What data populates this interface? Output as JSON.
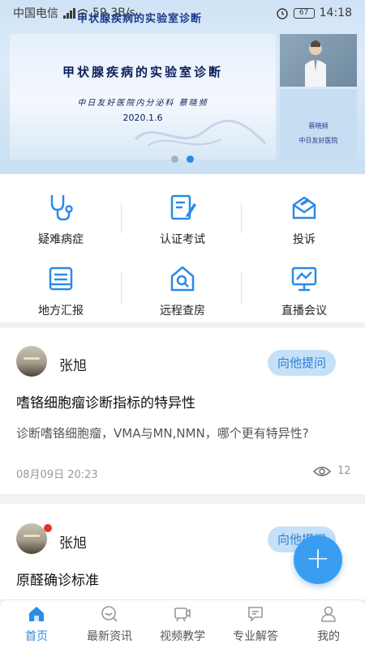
{
  "status": {
    "carrier": "中国电信",
    "net_speed": "59.3B/s",
    "battery": "67",
    "time": "14:18"
  },
  "banner": {
    "top_title": "甲状腺疾病的实验室诊断",
    "title": "甲状腺疾病的实验室诊断",
    "subtitle": "中日友好医院内分泌科 蔡晓频",
    "date": "2020.1.6",
    "side_name": "蔡晓频",
    "side_hospital": "中日友好医院",
    "slide_count": 2,
    "active_slide": 2
  },
  "menu": [
    {
      "label": "疑难病症",
      "icon": "stethoscope-icon"
    },
    {
      "label": "认证考试",
      "icon": "edit-document-icon"
    },
    {
      "label": "投诉",
      "icon": "complaint-envelope-icon"
    },
    {
      "label": "地方汇报",
      "icon": "report-icon"
    },
    {
      "label": "远程查房",
      "icon": "remote-ward-icon"
    },
    {
      "label": "直播会议",
      "icon": "live-meeting-icon"
    }
  ],
  "posts": [
    {
      "user": "张旭",
      "ask_label": "向他提问",
      "title": "嗜铬细胞瘤诊断指标的特异性",
      "description": "诊断嗜铬细胞瘤，VMA与MN,NMN，哪个更有特异性?",
      "time": "08月09日 20:23",
      "views": "12"
    },
    {
      "user": "张旭",
      "ask_label": "向他提问",
      "title": "原醛确诊标准"
    }
  ],
  "fab_label": "+",
  "tabs": [
    {
      "label": "首页",
      "icon": "home-icon",
      "active": true
    },
    {
      "label": "最新资讯",
      "icon": "news-icon"
    },
    {
      "label": "视频教学",
      "icon": "video-icon"
    },
    {
      "label": "专业解答",
      "icon": "answer-icon"
    },
    {
      "label": "我的",
      "icon": "profile-icon"
    }
  ],
  "colors": {
    "accent": "#2b8be6",
    "ask_bg": "#c6e1f7",
    "fab": "#3a9ef0"
  }
}
